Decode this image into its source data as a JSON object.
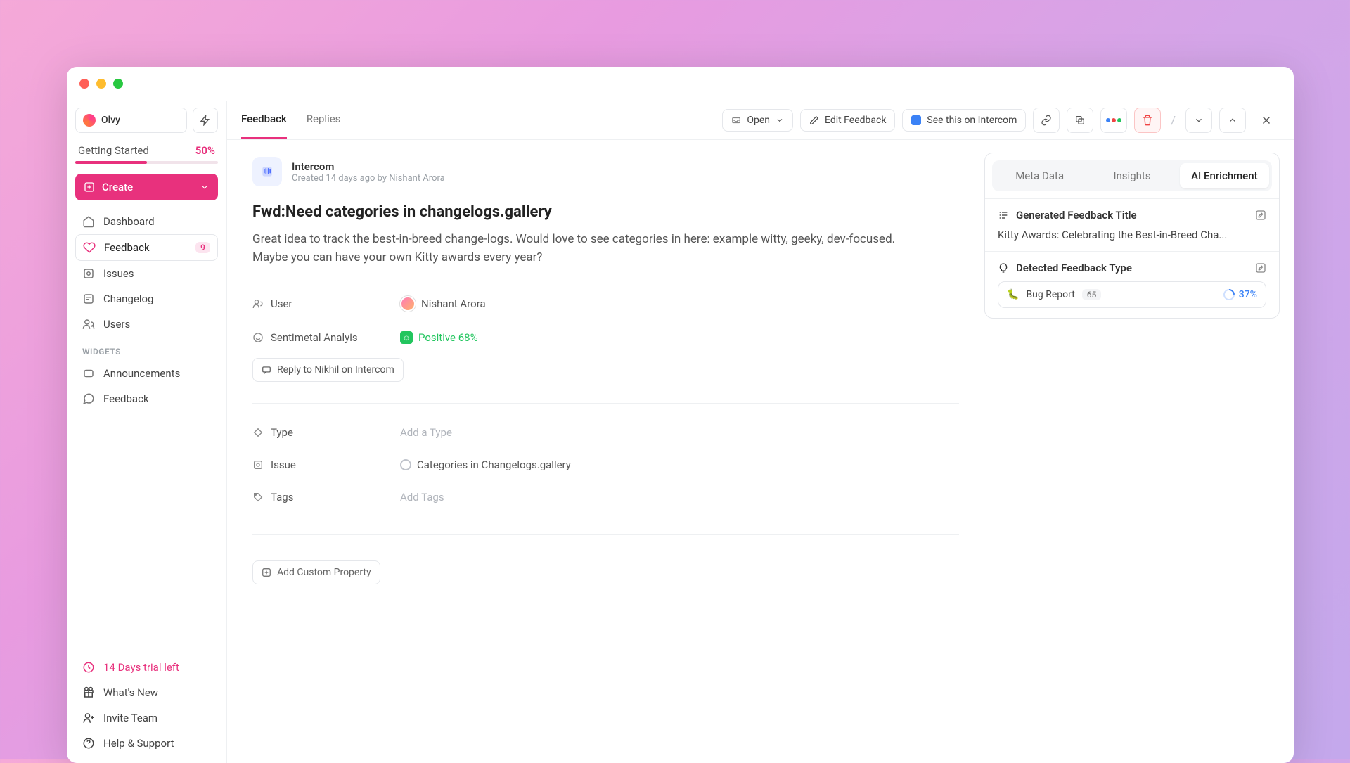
{
  "brand": {
    "name": "Olvy"
  },
  "sidebar": {
    "getting_started": {
      "label": "Getting Started",
      "pct": "50%"
    },
    "create": "Create",
    "nav": [
      {
        "label": "Dashboard"
      },
      {
        "label": "Feedback",
        "badge": "9"
      },
      {
        "label": "Issues"
      },
      {
        "label": "Changelog"
      },
      {
        "label": "Users"
      }
    ],
    "widgets_label": "WIDGETS",
    "widgets": [
      {
        "label": "Announcements"
      },
      {
        "label": "Feedback"
      }
    ],
    "bottom": {
      "trial": "14 Days trial left",
      "whats_new": "What's New",
      "invite": "Invite Team",
      "help": "Help & Support"
    }
  },
  "topbar": {
    "tabs": {
      "feedback": "Feedback",
      "replies": "Replies"
    },
    "open": "Open",
    "edit": "Edit Feedback",
    "intercom": "See this on Intercom"
  },
  "feed": {
    "source": "Intercom",
    "created": "Created 14 days ago by Nishant Arora",
    "title": "Fwd:Need categories in changelogs.gallery",
    "body": "Great idea to track the best-in-breed change-logs. Would love to see categories in here: example witty, geeky, dev-focused. Maybe you can have your own Kitty awards every year?",
    "user_label": "User",
    "user_value": "Nishant Arora",
    "sentiment_label": "Sentimetal Analyis",
    "sentiment_value": "Positive 68%",
    "reply": "Reply to Nikhil on Intercom",
    "type_label": "Type",
    "type_placeholder": "Add a Type",
    "issue_label": "Issue",
    "issue_value": "Categories in Changelogs.gallery",
    "tags_label": "Tags",
    "tags_placeholder": "Add Tags",
    "add_prop": "Add Custom Property"
  },
  "ai": {
    "tabs": {
      "meta": "Meta Data",
      "insights": "Insights",
      "enrich": "AI Enrichment"
    },
    "gen_title_label": "Generated Feedback Title",
    "gen_title_value": "Kitty Awards: Celebrating the Best-in-Breed Cha...",
    "type_label": "Detected Feedback Type",
    "type_value": "Bug Report",
    "type_count": "65",
    "type_pct": "37%"
  }
}
